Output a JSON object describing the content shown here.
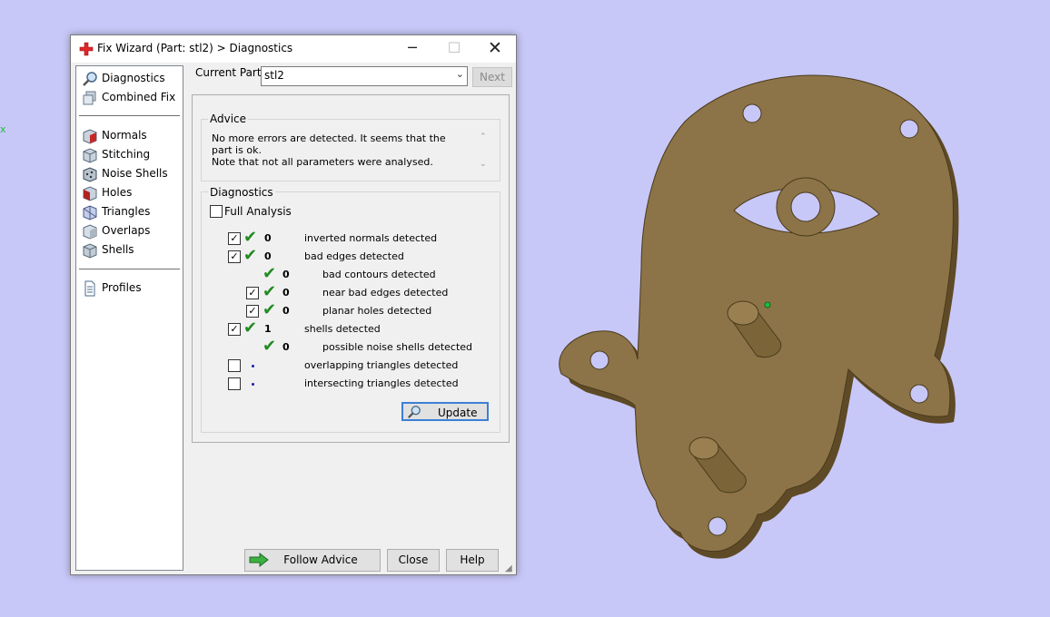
{
  "window": {
    "title": "Fix Wizard (Part: stl2) > Diagnostics",
    "minimize_glyph": "─",
    "maximize_glyph": "☐",
    "close_glyph": "✕"
  },
  "viewport": {
    "background_color": "#c8c8f8",
    "part_color": "#8c7448",
    "axis_fragment": "x"
  },
  "nav": {
    "items": [
      {
        "label": "Diagnostics",
        "icon": "diagnostics-magnifier-icon"
      },
      {
        "label": "Combined Fix",
        "icon": "combined-fix-icon"
      },
      {
        "label": "Normals",
        "icon": "normals-cube-icon"
      },
      {
        "label": "Stitching",
        "icon": "stitching-cube-icon"
      },
      {
        "label": "Noise Shells",
        "icon": "noise-shells-cube-icon"
      },
      {
        "label": "Holes",
        "icon": "holes-cube-icon"
      },
      {
        "label": "Triangles",
        "icon": "triangles-cube-icon"
      },
      {
        "label": "Overlaps",
        "icon": "overlaps-cube-icon"
      },
      {
        "label": "Shells",
        "icon": "shells-cube-icon"
      },
      {
        "label": "Profiles",
        "icon": "profiles-document-icon"
      }
    ]
  },
  "current_part": {
    "label": "Current Part:",
    "value": "stl2",
    "next_label": "Next"
  },
  "advice": {
    "title": "Advice",
    "line1": "No more errors are detected. It seems that the part is ok.",
    "line2": "Note that not all parameters were analysed."
  },
  "diagnostics": {
    "title": "Diagnostics",
    "full_analysis_label": "Full Analysis",
    "rows": [
      {
        "label": "inverted normals detected",
        "count": "0",
        "checked": true
      },
      {
        "label": "bad edges detected",
        "count": "0",
        "checked": true
      },
      {
        "label": "bad contours detected",
        "count": "0",
        "checked": false
      },
      {
        "label": "near bad edges detected",
        "count": "0",
        "checked": true
      },
      {
        "label": "planar holes detected",
        "count": "0",
        "checked": true
      },
      {
        "label": "shells detected",
        "count": "1",
        "checked": true
      },
      {
        "label": "possible noise shells detected",
        "count": "0",
        "checked": false
      },
      {
        "label": "overlapping triangles detected",
        "count": "",
        "checked": false
      },
      {
        "label": "intersecting triangles detected",
        "count": "",
        "checked": false
      }
    ],
    "update_label": "Update"
  },
  "buttons": {
    "follow_advice": "Follow Advice",
    "close": "Close",
    "help": "Help"
  }
}
